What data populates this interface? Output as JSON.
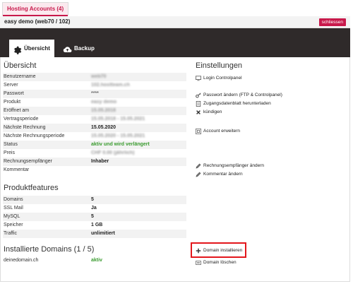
{
  "tab": {
    "label": "Hosting Accounts (4)"
  },
  "account": {
    "title": "easy demo (web70 / 102)",
    "close_label": "schliessen"
  },
  "tabs": [
    {
      "label": "Übersicht",
      "icon": "gear-icon",
      "active": true
    },
    {
      "label": "Backup",
      "icon": "cloud-upload-icon",
      "active": false
    }
  ],
  "overview": {
    "title": "Übersicht",
    "rows": [
      {
        "label": "Benutzername",
        "value": "web70"
      },
      {
        "label": "Server",
        "value": "102.hostteam.ch"
      },
      {
        "label": "Passwort",
        "value": "****"
      },
      {
        "label": "Produkt",
        "value": "easy demo"
      },
      {
        "label": "Eröffnet am",
        "value": "15.05.2018"
      },
      {
        "label": "Vertragsperiode",
        "value": "15.05.2018 - 15.05.2021"
      },
      {
        "label": "Nächste Rechnung",
        "value": "15.05.2020"
      },
      {
        "label": "Nächste Rechnungsperiode",
        "value": "15.05.2020 - 15.05.2021"
      },
      {
        "label": "Status",
        "value": "aktiv und wird verlängert"
      },
      {
        "label": "Preis",
        "value": "CHF 0.00 (jährlich)"
      },
      {
        "label": "Rechnungsempfänger",
        "value": "Inhaber"
      },
      {
        "label": "Kommentar",
        "value": ""
      }
    ]
  },
  "features": {
    "title": "Produktfeatures",
    "rows": [
      {
        "label": "Domains",
        "value": "5"
      },
      {
        "label": "SSL Mail",
        "value": "Ja"
      },
      {
        "label": "MySQL",
        "value": "5"
      },
      {
        "label": "Speicher",
        "value": "1 GB"
      },
      {
        "label": "Traffic",
        "value": "unlimitiert"
      }
    ]
  },
  "domains": {
    "title": "Installierte Domains (1 / 5)",
    "rows": [
      {
        "label": "deinedomain.ch",
        "value": "aktiv"
      }
    ]
  },
  "settings": {
    "title": "Einstellungen",
    "links": [
      {
        "label": "Login Controlpanel",
        "icon": "monitor-icon"
      },
      {
        "label": "Passwort ändern (FTP & Controlpanel)",
        "icon": "key-icon"
      },
      {
        "label": "Zugangsdatenblatt herunterladen",
        "icon": "document-icon"
      },
      {
        "label": "kündigen",
        "icon": "close-icon"
      },
      {
        "label": "Account erweitern",
        "icon": "expand-icon"
      },
      {
        "label": "Rechnungsempfänger ändern",
        "icon": "pencil-icon"
      },
      {
        "label": "Kommentar ändern",
        "icon": "pencil-icon"
      },
      {
        "label": "Domain installieren",
        "icon": "plus-icon"
      },
      {
        "label": "Domain löschen",
        "icon": "minus-icon"
      }
    ]
  },
  "colors": {
    "accent": "#c8194b",
    "dark_bar": "#2f2a2a",
    "status_green": "#3a9b2f",
    "highlight": "#e3171c"
  }
}
